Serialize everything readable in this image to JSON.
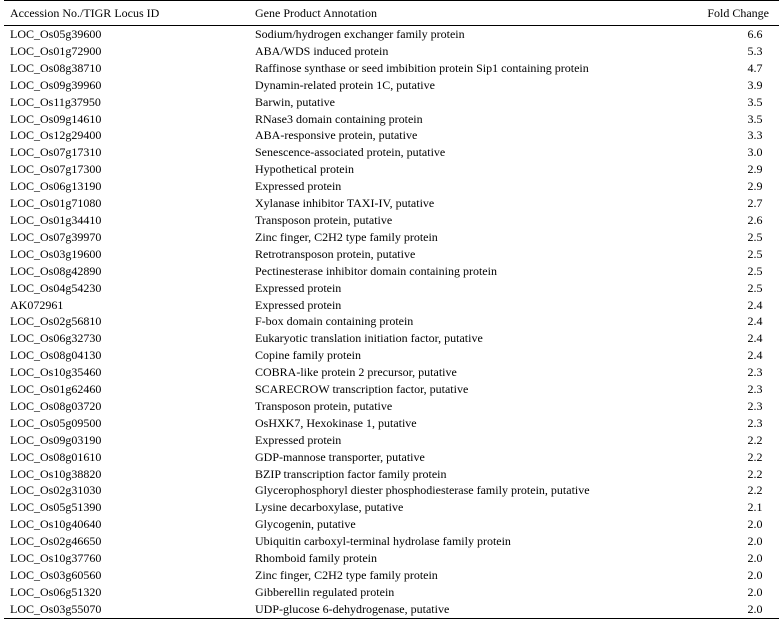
{
  "table": {
    "headers": {
      "accession": "Accession No./TIGR Locus ID",
      "annotation": "Gene Product Annotation",
      "fold": "Fold Change"
    },
    "rows": [
      {
        "id": "LOC_Os05g39600",
        "annotation": "Sodium/hydrogen exchanger family protein",
        "fold": "6.6"
      },
      {
        "id": "LOC_Os01g72900",
        "annotation": "ABA/WDS induced protein",
        "fold": "5.3"
      },
      {
        "id": "LOC_Os08g38710",
        "annotation": "Raffinose synthase or seed imbibition protein Sip1 containing protein",
        "fold": "4.7"
      },
      {
        "id": "LOC_Os09g39960",
        "annotation": "Dynamin-related protein 1C, putative",
        "fold": "3.9"
      },
      {
        "id": "LOC_Os11g37950",
        "annotation": "Barwin, putative",
        "fold": "3.5"
      },
      {
        "id": "LOC_Os09g14610",
        "annotation": "RNase3 domain containing protein",
        "fold": "3.5"
      },
      {
        "id": "LOC_Os12g29400",
        "annotation": "ABA-responsive protein, putative",
        "fold": "3.3"
      },
      {
        "id": "LOC_Os07g17310",
        "annotation": "Senescence-associated protein, putative",
        "fold": "3.0"
      },
      {
        "id": "LOC_Os07g17300",
        "annotation": "Hypothetical protein",
        "fold": "2.9"
      },
      {
        "id": "LOC_Os06g13190",
        "annotation": "Expressed protein",
        "fold": "2.9"
      },
      {
        "id": "LOC_Os01g71080",
        "annotation": "Xylanase inhibitor TAXI-IV, putative",
        "fold": "2.7"
      },
      {
        "id": "LOC_Os01g34410",
        "annotation": "Transposon protein, putative",
        "fold": "2.6"
      },
      {
        "id": "LOC_Os07g39970",
        "annotation": "Zinc finger, C2H2 type family protein",
        "fold": "2.5"
      },
      {
        "id": "LOC_Os03g19600",
        "annotation": "Retrotransposon protein, putative",
        "fold": "2.5"
      },
      {
        "id": "LOC_Os08g42890",
        "annotation": "Pectinesterase inhibitor domain containing protein",
        "fold": "2.5"
      },
      {
        "id": "LOC_Os04g54230",
        "annotation": "Expressed protein",
        "fold": "2.5"
      },
      {
        "id": "AK072961",
        "annotation": "Expressed protein",
        "fold": "2.4"
      },
      {
        "id": "LOC_Os02g56810",
        "annotation": "F-box domain containing protein",
        "fold": "2.4"
      },
      {
        "id": "LOC_Os06g32730",
        "annotation": "Eukaryotic translation initiation factor, putative",
        "fold": "2.4"
      },
      {
        "id": "LOC_Os08g04130",
        "annotation": "Copine family protein",
        "fold": "2.4"
      },
      {
        "id": "LOC_Os10g35460",
        "annotation": "COBRA-like protein 2 precursor, putative",
        "fold": "2.3"
      },
      {
        "id": "LOC_Os01g62460",
        "annotation": "SCARECROW transcription factor, putative",
        "fold": "2.3"
      },
      {
        "id": "LOC_Os08g03720",
        "annotation": "Transposon protein, putative",
        "fold": "2.3"
      },
      {
        "id": "LOC_Os05g09500",
        "annotation": "OsHXK7, Hexokinase 1, putative",
        "fold": "2.3"
      },
      {
        "id": "LOC_Os09g03190",
        "annotation": "Expressed protein",
        "fold": "2.2"
      },
      {
        "id": "LOC_Os08g01610",
        "annotation": "GDP-mannose transporter, putative",
        "fold": "2.2"
      },
      {
        "id": "LOC_Os10g38820",
        "annotation": "BZIP transcription factor family protein",
        "fold": "2.2"
      },
      {
        "id": "LOC_Os02g31030",
        "annotation": "Glycerophosphoryl diester phosphodiesterase family protein, putative",
        "fold": "2.2"
      },
      {
        "id": "LOC_Os05g51390",
        "annotation": "Lysine decarboxylase, putative",
        "fold": "2.1"
      },
      {
        "id": "LOC_Os10g40640",
        "annotation": "Glycogenin, putative",
        "fold": "2.0"
      },
      {
        "id": "LOC_Os02g46650",
        "annotation": "Ubiquitin carboxyl-terminal hydrolase family protein",
        "fold": "2.0"
      },
      {
        "id": "LOC_Os10g37760",
        "annotation": "Rhomboid family protein",
        "fold": "2.0"
      },
      {
        "id": "LOC_Os03g60560",
        "annotation": "Zinc finger, C2H2 type family protein",
        "fold": "2.0"
      },
      {
        "id": "LOC_Os06g51320",
        "annotation": "Gibberellin regulated protein",
        "fold": "2.0"
      },
      {
        "id": "LOC_Os03g55070",
        "annotation": "UDP-glucose 6-dehydrogenase, putative",
        "fold": "2.0"
      }
    ]
  }
}
